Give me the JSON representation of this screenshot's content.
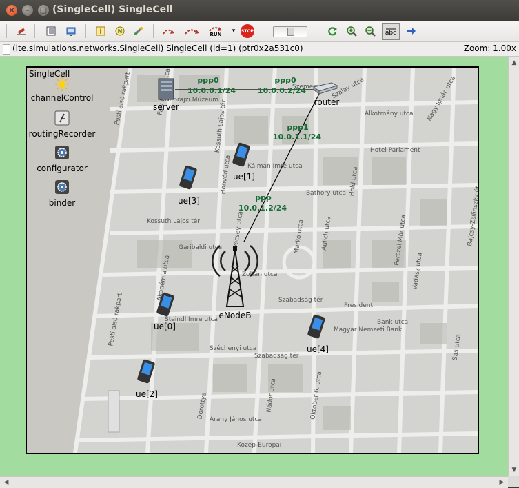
{
  "window": {
    "title": "(SingleCell) SingleCell",
    "buttons": [
      "close-icon",
      "minimize-icon",
      "maximize-icon"
    ]
  },
  "toolbar": {
    "run_label": "RUN",
    "stop_label": "STOP",
    "abc_label": "abc",
    "icons": [
      "rebuild-icon",
      "object-tree-icon",
      "log-window-icon",
      "info-icon",
      "network-icon",
      "tools-icon",
      "step-icon",
      "fast-icon",
      "run-icon",
      "run-dropdown-icon",
      "stop-icon",
      "speed-slider",
      "refresh-icon",
      "zoom-in-icon",
      "zoom-out-icon",
      "labels-toggle-icon",
      "arrow-icon"
    ]
  },
  "pathbar": {
    "path": "(lte.simulations.networks.SingleCell) SingleCell  (id=1)  (ptr0x2a531c0)",
    "zoom": "Zoom: 1.00x"
  },
  "network": {
    "name": "SingleCell",
    "modules": {
      "channelControl": "channelControl",
      "routingRecorder": "routingRecorder",
      "configurator": "configurator",
      "binder": "binder",
      "server": "server",
      "router": "router",
      "enodeb": "eNodeB",
      "ue0": "ue[0]",
      "ue1": "ue[1]",
      "ue2": "ue[2]",
      "ue3": "ue[3]",
      "ue4": "ue[4]"
    },
    "links": {
      "server_if": "ppp0",
      "server_ip": "10.0.0.1/24",
      "router_if0": "ppp0",
      "router_ip0": "10.0.0.2/24",
      "router_if1": "ppp1",
      "router_ip1": "10.0.1.1/24",
      "enb_if": "ppp",
      "enb_ip": "10.0.1.2/24"
    },
    "map_labels": {
      "s1": "Pesti alsó rakpart",
      "s2": "Kossuth Lajos tér",
      "s3": "Nádor utca",
      "s4": "Szabadság tér",
      "s5": "Bank utca",
      "s6": "Október 6. utca",
      "s7": "Arany János utca",
      "s8": "Alkotmány utca",
      "s9": "Hold utca",
      "s10": "Bathory utca",
      "s11": "Garibaldi utca",
      "s12": "Akadémia utca",
      "s13": "Széchenyi utca",
      "s14": "Zoltán utca",
      "s15": "Kossuth Lajos tér",
      "s16": "Néprajzi Múzeum",
      "s17": "Hotel Parlament",
      "s18": "President",
      "s19": "Magyar Nemzeti Bank",
      "s20": "Falk Miksa utca",
      "s21": "Vadász utca",
      "s22": "Nagy Ignác utca",
      "s23": "Kálmán Imre utca",
      "s24": "Steindl Imre utca",
      "s25": "Szemere utca",
      "s26": "Aulich utca",
      "s27": "Bajcsy-Zsilinszky út",
      "s28": "Kozep-Europai",
      "s29": "Sas utca",
      "s30": "Perczel Mór utca",
      "s31": "Markó utca",
      "s32": "Szalay utca",
      "s33": "Vécsey utca",
      "s34": "Honvéd utca",
      "s35": "Dorottya",
      "s36": "Szabadság tér"
    }
  }
}
